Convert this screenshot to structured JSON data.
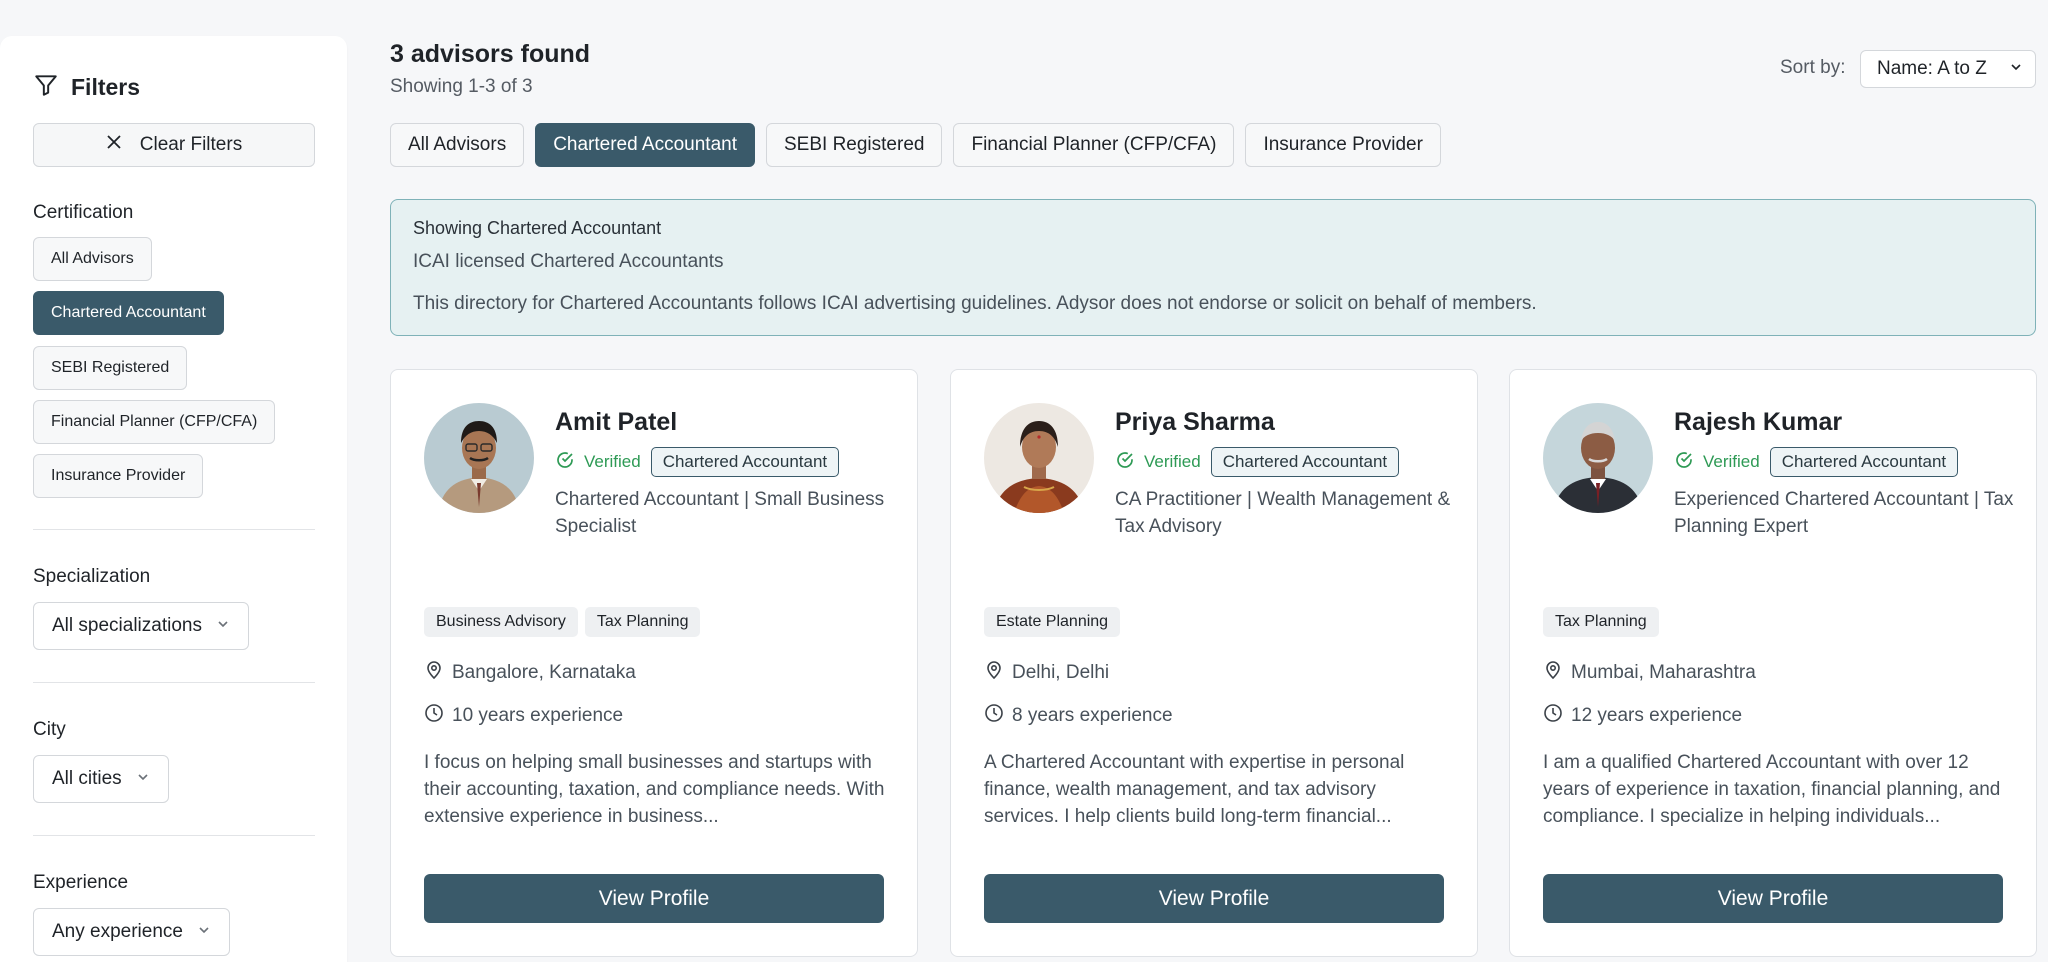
{
  "sidebar": {
    "title": "Filters",
    "clear_label": "Clear Filters",
    "certification_label": "Certification",
    "certifications": [
      "All Advisors",
      "Chartered Accountant",
      "SEBI Registered",
      "Financial Planner (CFP/CFA)",
      "Insurance Provider"
    ],
    "active_certification": "Chartered Accountant",
    "specialization_label": "Specialization",
    "specialization_value": "All specializations",
    "city_label": "City",
    "city_value": "All cities",
    "experience_label": "Experience",
    "experience_value": "Any experience"
  },
  "header": {
    "title": "3 advisors found",
    "subtitle": "Showing 1-3 of 3",
    "sort_label": "Sort by:",
    "sort_value": "Name: A to Z"
  },
  "tabs": [
    "All Advisors",
    "Chartered Accountant",
    "SEBI Registered",
    "Financial Planner (CFP/CFA)",
    "Insurance Provider"
  ],
  "active_tab": "Chartered Accountant",
  "notice": {
    "title": "Showing Chartered Accountant",
    "desc": "ICAI licensed Chartered Accountants",
    "body": "This directory for Chartered Accountants follows ICAI advertising guidelines. Adysor does not endorse or solicit on behalf of members."
  },
  "advisors": [
    {
      "name": "Amit Patel",
      "verified": "Verified",
      "cert": "Chartered Accountant",
      "headline": "Chartered Accountant | Small Business Specialist",
      "tags": [
        "Business Advisory",
        "Tax Planning"
      ],
      "location": "Bangalore, Karnataka",
      "experience": "10 years experience",
      "bio": "I focus on helping small businesses and startups with their accounting, taxation, and compliance needs. With extensive experience in business...",
      "button": "View Profile"
    },
    {
      "name": "Priya Sharma",
      "verified": "Verified",
      "cert": "Chartered Accountant",
      "headline": "CA Practitioner | Wealth Management & Tax Advisory",
      "tags": [
        "Estate Planning"
      ],
      "location": "Delhi, Delhi",
      "experience": "8 years experience",
      "bio": "A Chartered Accountant with expertise in personal finance, wealth management, and tax advisory services. I help clients build long-term financial...",
      "button": "View Profile"
    },
    {
      "name": "Rajesh Kumar",
      "verified": "Verified",
      "cert": "Chartered Accountant",
      "headline": "Experienced Chartered Accountant | Tax Planning Expert",
      "tags": [
        "Tax Planning"
      ],
      "location": "Mumbai, Maharashtra",
      "experience": "12 years experience",
      "bio": "I am a qualified Chartered Accountant with over 12 years of experience in taxation, financial planning, and compliance. I specialize in helping individuals...",
      "button": "View Profile"
    }
  ],
  "colors": {
    "accent": "#3a5a6a",
    "verified": "#2e9a55",
    "notice_bg": "#e6f1f2"
  }
}
